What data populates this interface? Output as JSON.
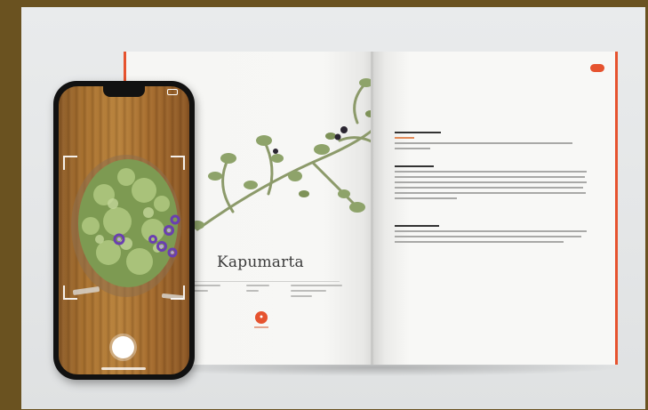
{
  "book": {
    "plant_name": "Kapumarta"
  },
  "phone": {
    "camera": {
      "shutter_label": "",
      "mode": "plant-scan"
    }
  },
  "colors": {
    "accent": "#e6532f",
    "frame": "#6a5220",
    "page": "#f7f7f5"
  },
  "icons": {
    "shutter": "shutter-button-icon",
    "battery": "battery-icon",
    "book_badge": "book-badge-icon"
  }
}
